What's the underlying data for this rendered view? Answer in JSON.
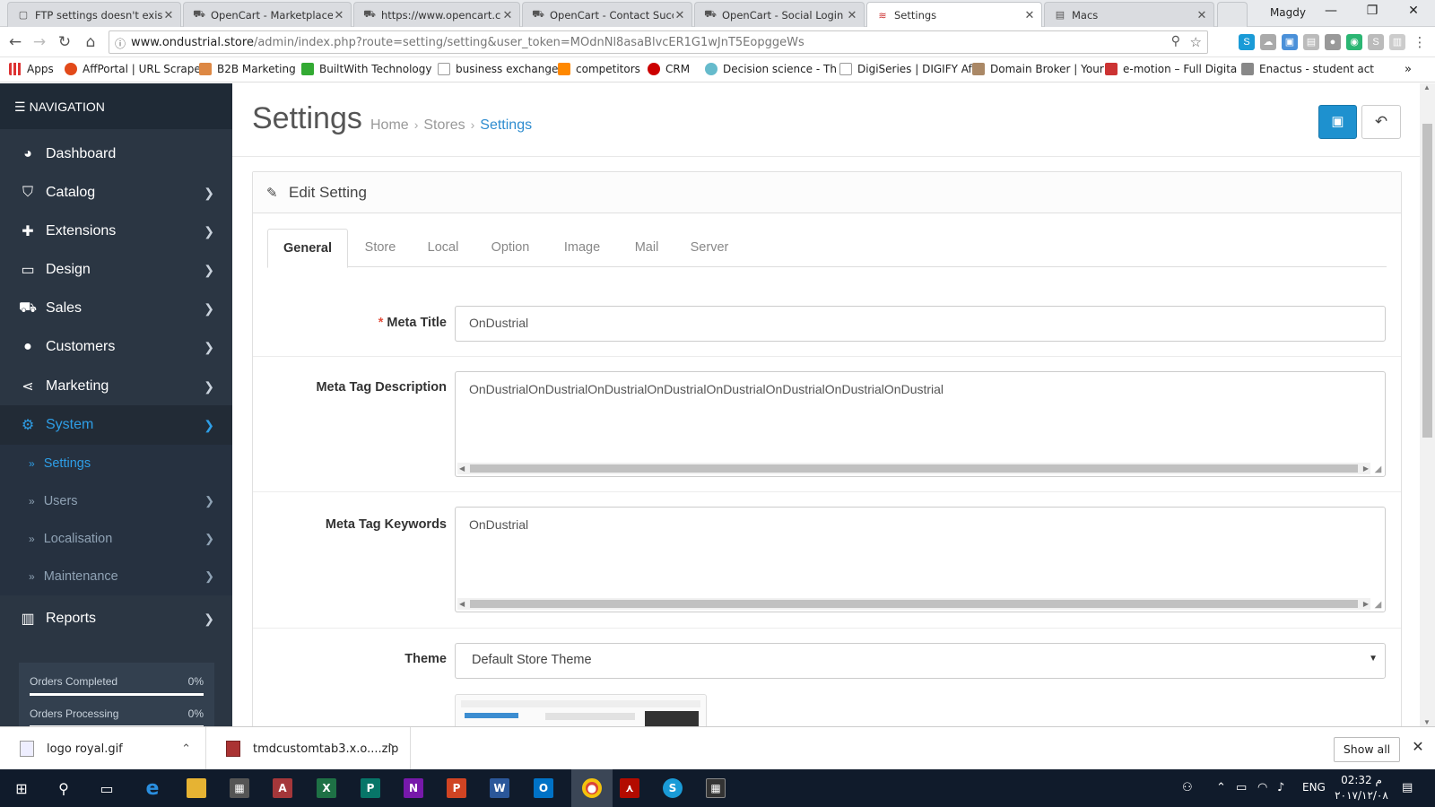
{
  "browser": {
    "tabs": [
      {
        "title": "FTP settings doesn't exis",
        "active": false
      },
      {
        "title": "OpenCart - Marketplace",
        "active": false
      },
      {
        "title": "https://www.opencart.co",
        "active": false
      },
      {
        "title": "OpenCart - Contact Succ",
        "active": false
      },
      {
        "title": "OpenCart - Social Login",
        "active": false
      },
      {
        "title": "Settings",
        "active": true
      },
      {
        "title": "Macs",
        "active": false
      }
    ],
    "user": "Magdy",
    "url_host": "www.ondustrial.store",
    "url_path": "/admin/index.php?route=setting/setting&user_token=MOdnNl8asaBlvcER1G1wJnT5EopggeWs",
    "bookmarks": [
      {
        "label": "Apps",
        "color": "#d33"
      },
      {
        "label": "AffPortal | URL Scrape",
        "color": "#e24a1a"
      },
      {
        "label": "B2B Marketing",
        "color": "#d84"
      },
      {
        "label": "BuiltWith Technology",
        "color": "#3a3"
      },
      {
        "label": "business exchange",
        "color": "#bbb"
      },
      {
        "label": "competitors",
        "color": "#f80"
      },
      {
        "label": "CRM",
        "color": "#c00"
      },
      {
        "label": "Decision science - Th",
        "color": "#6bc"
      },
      {
        "label": "DigiSeries | DIGIFY Af",
        "color": "#bbb"
      },
      {
        "label": "Domain Broker | Your",
        "color": "#a86"
      },
      {
        "label": "e-motion – Full Digita",
        "color": "#c33"
      },
      {
        "label": "Enactus - student act",
        "color": "#888"
      }
    ]
  },
  "sidebar": {
    "header": "NAVIGATION",
    "items": [
      {
        "label": "Dashboard",
        "icon": "dashboard-icon",
        "glyph": "◕",
        "has_children": false
      },
      {
        "label": "Catalog",
        "icon": "tags-icon",
        "glyph": "⛉",
        "has_children": true
      },
      {
        "label": "Extensions",
        "icon": "puzzle-icon",
        "glyph": "✚",
        "has_children": true
      },
      {
        "label": "Design",
        "icon": "monitor-icon",
        "glyph": "▭",
        "has_children": true
      },
      {
        "label": "Sales",
        "icon": "cart-icon",
        "glyph": "⛟",
        "has_children": true
      },
      {
        "label": "Customers",
        "icon": "user-icon",
        "glyph": "●",
        "has_children": true
      },
      {
        "label": "Marketing",
        "icon": "share-icon",
        "glyph": "⋖",
        "has_children": true
      },
      {
        "label": "System",
        "icon": "gear-icon",
        "glyph": "⚙",
        "has_children": true
      }
    ],
    "system_children": [
      {
        "label": "Settings",
        "active": true,
        "has_children": false
      },
      {
        "label": "Users",
        "active": false,
        "has_children": true
      },
      {
        "label": "Localisation",
        "active": false,
        "has_children": true
      },
      {
        "label": "Maintenance",
        "active": false,
        "has_children": true
      }
    ],
    "reports": {
      "label": "Reports",
      "icon": "bar-chart-icon",
      "glyph": "▥"
    },
    "stats": [
      {
        "label": "Orders Completed",
        "value": "0%",
        "fraction": 0
      },
      {
        "label": "Orders Processing",
        "value": "0%",
        "fraction": 0
      }
    ]
  },
  "page": {
    "title": "Settings",
    "breadcrumb": [
      "Home",
      "Stores",
      "Settings"
    ],
    "save_icon": "save-icon",
    "back_icon": "reply-icon",
    "panel_title": "Edit Setting",
    "tabs": [
      "General",
      "Store",
      "Local",
      "Option",
      "Image",
      "Mail",
      "Server"
    ],
    "active_tab": "General",
    "fields": {
      "meta_title": {
        "label": "Meta Title",
        "required": true,
        "value": "OnDustrial"
      },
      "meta_description": {
        "label": "Meta Tag Description",
        "value": "OnDustrialOnDustrialOnDustrialOnDustrialOnDustrialOnDustrialOnDustrialOnDustrial"
      },
      "meta_keywords": {
        "label": "Meta Tag Keywords",
        "value": "OnDustrial"
      },
      "theme": {
        "label": "Theme",
        "value": "Default Store Theme"
      }
    },
    "accent_color": "#1e91cf"
  },
  "downloads": {
    "items": [
      {
        "name": "logo royal.gif"
      },
      {
        "name": "tmdcustomtab3.x.o....zip"
      }
    ],
    "show_all": "Show all"
  },
  "taskbar": {
    "lang": "ENG",
    "time": "02:32 م",
    "date": "٢٠١٧/١٢/٠٨"
  }
}
